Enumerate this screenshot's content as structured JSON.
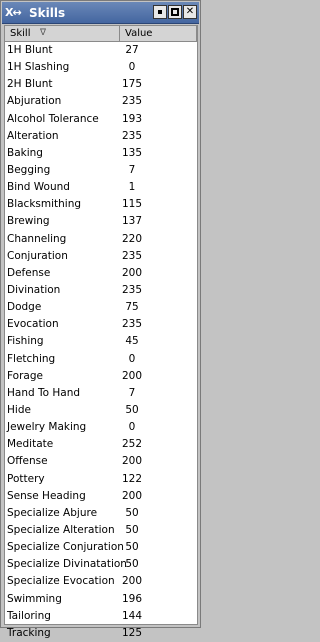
{
  "window": {
    "title": "Skills",
    "app_icon": "X↔",
    "buttons": [
      "minimize",
      "maximize",
      "close"
    ]
  },
  "table": {
    "columns": [
      "Skill",
      "Value"
    ],
    "sort_indicator": "∇",
    "rows": [
      {
        "skill": "1H Blunt",
        "value": "27"
      },
      {
        "skill": "1H Slashing",
        "value": "0"
      },
      {
        "skill": "2H Blunt",
        "value": "175"
      },
      {
        "skill": "Abjuration",
        "value": "235"
      },
      {
        "skill": "Alcohol Tolerance",
        "value": "193"
      },
      {
        "skill": "Alteration",
        "value": "235"
      },
      {
        "skill": "Baking",
        "value": "135"
      },
      {
        "skill": "Begging",
        "value": "7"
      },
      {
        "skill": "Bind Wound",
        "value": "1"
      },
      {
        "skill": "Blacksmithing",
        "value": "115"
      },
      {
        "skill": "Brewing",
        "value": "137"
      },
      {
        "skill": "Channeling",
        "value": "220"
      },
      {
        "skill": "Conjuration",
        "value": "235"
      },
      {
        "skill": "Defense",
        "value": "200"
      },
      {
        "skill": "Divination",
        "value": "235"
      },
      {
        "skill": "Dodge",
        "value": "75"
      },
      {
        "skill": "Evocation",
        "value": "235"
      },
      {
        "skill": "Fishing",
        "value": "45"
      },
      {
        "skill": "Fletching",
        "value": "0"
      },
      {
        "skill": "Forage",
        "value": "200"
      },
      {
        "skill": "Hand To Hand",
        "value": "7"
      },
      {
        "skill": "Hide",
        "value": "50"
      },
      {
        "skill": "Jewelry Making",
        "value": "0"
      },
      {
        "skill": "Meditate",
        "value": "252"
      },
      {
        "skill": "Offense",
        "value": "200"
      },
      {
        "skill": "Pottery",
        "value": "122"
      },
      {
        "skill": "Sense Heading",
        "value": "200"
      },
      {
        "skill": "Specialize Abjure",
        "value": "50"
      },
      {
        "skill": "Specialize Alteration",
        "value": "50"
      },
      {
        "skill": "Specialize Conjuration",
        "value": "50"
      },
      {
        "skill": "Specialize Divinatation",
        "value": "50"
      },
      {
        "skill": "Specialize Evocation",
        "value": "200"
      },
      {
        "skill": "Swimming",
        "value": "196"
      },
      {
        "skill": "Tailoring",
        "value": "144"
      },
      {
        "skill": "Tracking",
        "value": "125"
      }
    ]
  }
}
